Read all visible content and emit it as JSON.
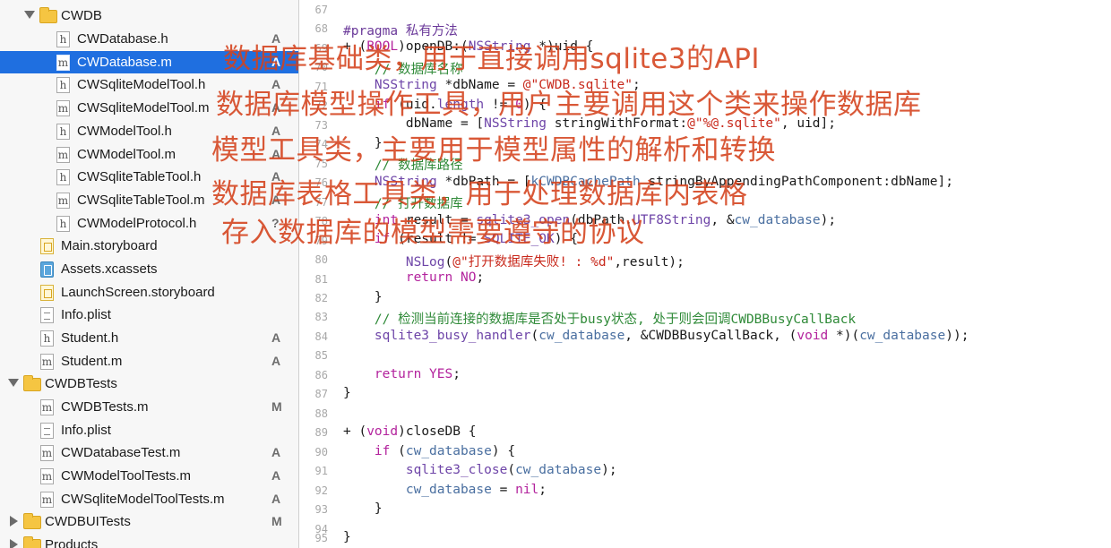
{
  "sidebar": {
    "items": [
      {
        "label": "CWDB",
        "status": ""
      },
      {
        "label": "CWDatabase.h",
        "status": "A",
        "icon": "h"
      },
      {
        "label": "CWDatabase.m",
        "status": "A",
        "icon": "m"
      },
      {
        "label": "CWSqliteModelTool.h",
        "status": "A",
        "icon": "h"
      },
      {
        "label": "CWSqliteModelTool.m",
        "status": "A",
        "icon": "m"
      },
      {
        "label": "CWModelTool.h",
        "status": "A",
        "icon": "h"
      },
      {
        "label": "CWModelTool.m",
        "status": "A",
        "icon": "m"
      },
      {
        "label": "CWSqliteTableTool.h",
        "status": "A",
        "icon": "h"
      },
      {
        "label": "CWSqliteTableTool.m",
        "status": "A",
        "icon": "m"
      },
      {
        "label": "CWModelProtocol.h",
        "status": "?",
        "icon": "h"
      },
      {
        "label": "Main.storyboard",
        "status": ""
      },
      {
        "label": "Assets.xcassets",
        "status": ""
      },
      {
        "label": "LaunchScreen.storyboard",
        "status": ""
      },
      {
        "label": "Info.plist",
        "status": ""
      },
      {
        "label": "Student.h",
        "status": "A",
        "icon": "h"
      },
      {
        "label": "Student.m",
        "status": "A",
        "icon": "m"
      },
      {
        "label": "CWDBTests",
        "status": ""
      },
      {
        "label": "CWDBTests.m",
        "status": "M",
        "icon": "m"
      },
      {
        "label": "Info.plist",
        "status": ""
      },
      {
        "label": "CWDatabaseTest.m",
        "status": "A",
        "icon": "m"
      },
      {
        "label": "CWModelToolTests.m",
        "status": "A",
        "icon": "m"
      },
      {
        "label": "CWSqliteModelToolTests.m",
        "status": "A",
        "icon": "m"
      },
      {
        "label": "CWDBUITests",
        "status": "M"
      },
      {
        "label": "Products",
        "status": ""
      }
    ]
  },
  "editor": {
    "line_numbers": [
      "67",
      "68",
      "69",
      "70",
      "71",
      "72",
      "73",
      "74",
      "75",
      "76",
      "77",
      "78",
      "79",
      "80",
      "81",
      "82",
      "83",
      "84",
      "85",
      "86",
      "87",
      "88",
      "89",
      "90",
      "91",
      "92",
      "93",
      "94",
      "95"
    ]
  },
  "code": {
    "l68": "#pragma 私有方法",
    "l69a": "+ (",
    "l69b": "BOOL",
    "l69c": ")openDB:(",
    "l69d": "NSString",
    "l69e": " *)uid {",
    "l70": "    // 数据库名称",
    "l71a": "    ",
    "l71b": "NSString",
    "l71c": " *dbName = ",
    "l71d": "@\"CWDB.sqlite\"",
    "l71e": ";",
    "l72a": "    ",
    "l72b": "if",
    "l72c": " (uid.",
    "l72d": "length",
    "l72e": " != ",
    "l72f": "0",
    "l72g": ") {",
    "l73a": "        dbName = [",
    "l73b": "NSString",
    "l73c": " stringWithFormat:",
    "l73d": "@\"%@.sqlite\"",
    "l73e": ", uid];",
    "l74": "    }",
    "l75": "    // 数据库路径",
    "l76a": "    ",
    "l76b": "NSString",
    "l76c": " *dbPath = [",
    "l76d": "kCWDBCachePath",
    "l76e": " stringByAppendingPathComponent:dbName];",
    "l77": "    // 打开数据库",
    "l78a": "    ",
    "l78b": "int",
    "l78c": " result = ",
    "l78d": "sqlite3_open",
    "l78e": "(dbPath.",
    "l78f": "UTF8String",
    "l78g": ", &",
    "l78h": "cw_database",
    "l78i": ");",
    "l79a": "    ",
    "l79b": "if",
    "l79c": " (result != ",
    "l79d": "SQLITE_OK",
    "l79e": ") {",
    "l80a": "        ",
    "l80b": "NSLog",
    "l80c": "(",
    "l80d": "@\"打开数据库失败! : %d\"",
    "l80e": ",result);",
    "l81a": "        ",
    "l81b": "return",
    "l81c": " ",
    "l81d": "NO",
    "l81e": ";",
    "l82": "    }",
    "l83": "    // 检测当前连接的数据库是否处于busy状态, 处于则会回调CWDBBusyCallBack",
    "l84a": "    ",
    "l84b": "sqlite3_busy_handler",
    "l84c": "(",
    "l84d": "cw_database",
    "l84e": ", &CWDBBusyCallBack, (",
    "l84f": "void",
    "l84g": " *)(",
    "l84h": "cw_database",
    "l84i": "));",
    "l86a": "    ",
    "l86b": "return",
    "l86c": " ",
    "l86d": "YES",
    "l86e": ";",
    "l87": "}",
    "l89a": "+ (",
    "l89b": "void",
    "l89c": ")closeDB {",
    "l90a": "    ",
    "l90b": "if",
    "l90c": " (",
    "l90d": "cw_database",
    "l90e": ") {",
    "l91a": "        ",
    "l91b": "sqlite3_close",
    "l91c": "(",
    "l91d": "cw_database",
    "l91e": ");",
    "l92a": "        ",
    "l92b": "cw_database",
    "l92c": " = ",
    "l92d": "nil",
    "l92e": ";",
    "l93": "    }",
    "l95": "}"
  },
  "annotations": [
    "数据库基础类，用于直接调用sqlite3的API",
    "数据库模型操作工具，用户主要调用这个类来操作数据库",
    "模型工具类，主要用于模型属性的解析和转换",
    "数据库表格工具类，用于处理数据库内表格",
    "存入数据库的模型需要遵守的协议"
  ],
  "colors": {
    "selection": "#1f6fe0",
    "keyword": "#b3239d",
    "string": "#c8291c",
    "comment": "#2f8a38",
    "annotation": "#d4421c"
  }
}
